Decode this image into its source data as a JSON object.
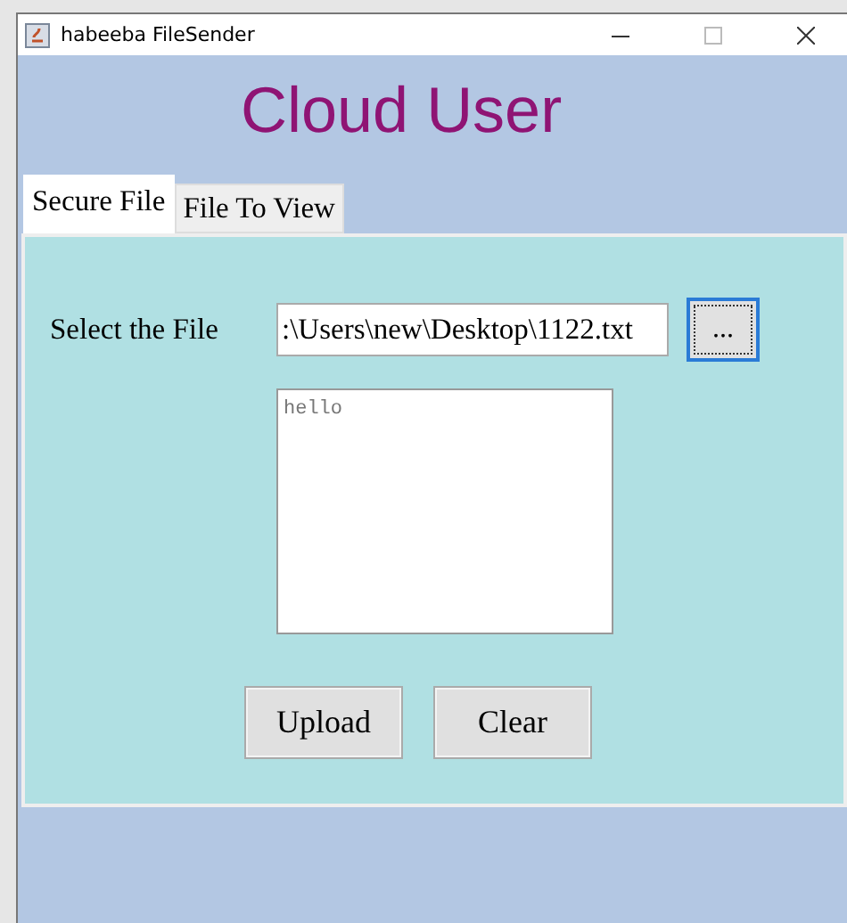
{
  "window": {
    "title": "habeeba FileSender"
  },
  "header": {
    "title": "Cloud User"
  },
  "tabs": [
    {
      "label": "Secure File",
      "selected": true
    },
    {
      "label": "File To View",
      "selected": false
    }
  ],
  "form": {
    "file_label": "Select the File",
    "file_path": ":\\Users\\new\\Desktop\\1122.txt",
    "browse_button": "...",
    "content": "hello"
  },
  "buttons": [
    "Upload",
    "Clear"
  ]
}
